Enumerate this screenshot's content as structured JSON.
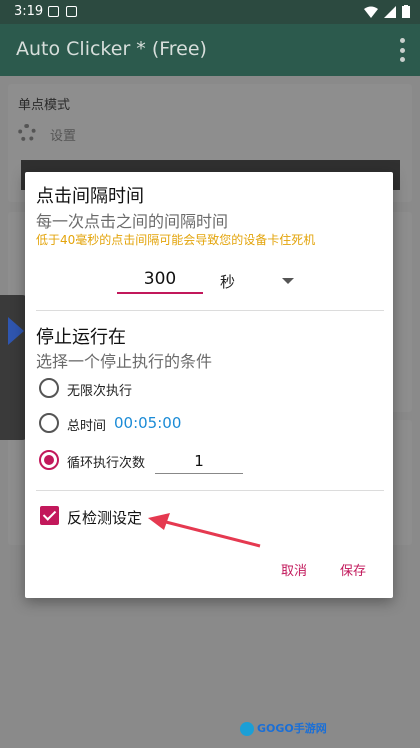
{
  "status_bar": {
    "time": "3:19"
  },
  "app_bar": {
    "title": "Auto Clicker * (Free)"
  },
  "background": {
    "section_title": "单点模式",
    "settings_label": "设置"
  },
  "dialog": {
    "interval": {
      "title": "点击间隔时间",
      "subtitle": "每一次点击之间的间隔时间",
      "warning": "低于40毫秒的点击间隔可能会导致您的设备卡住死机",
      "value": "300",
      "unit": "秒"
    },
    "stop": {
      "title": "停止运行在",
      "subtitle": "选择一个停止执行的条件",
      "options": [
        {
          "label": "无限次执行",
          "selected": false
        },
        {
          "label": "总时间",
          "selected": false,
          "value": "00:05:00"
        },
        {
          "label": "循环执行次数",
          "selected": true,
          "value": "1"
        }
      ]
    },
    "anti_detect": {
      "label": "反检测设定",
      "checked": true
    },
    "buttons": {
      "cancel": "取消",
      "save": "保存"
    }
  },
  "colors": {
    "accent": "#c2185b",
    "warning": "#e3a40b",
    "time_value": "#1b8bd6",
    "app_bar": "#2c5a4d"
  },
  "watermark": {
    "text": "GOGO手游网"
  }
}
